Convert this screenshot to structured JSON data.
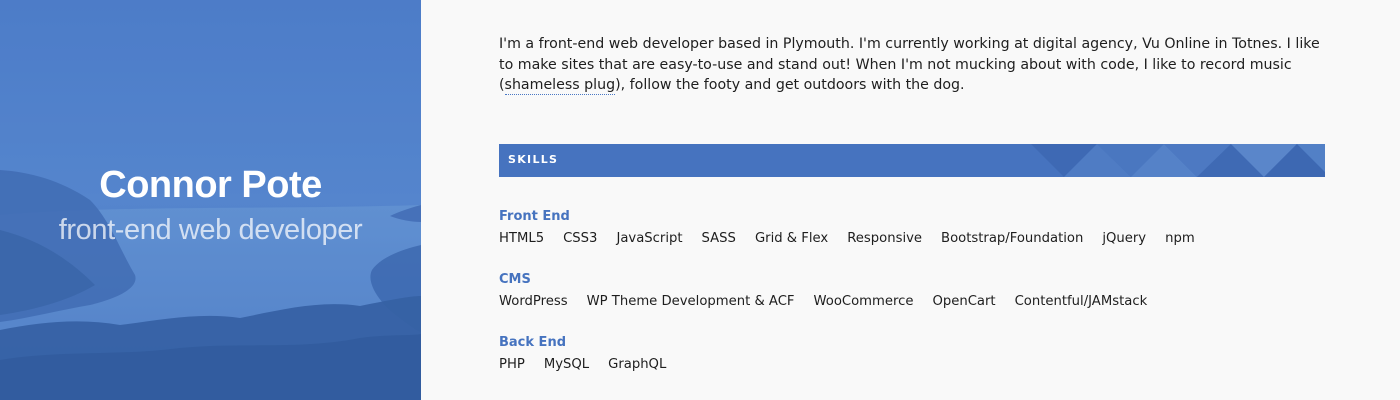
{
  "hero": {
    "name": "Connor Pote",
    "role": "front-end web developer"
  },
  "intro": {
    "text_before_link": "I'm a front-end web developer based in Plymouth. I'm currently working at digital agency, Vu Online in Totnes. I like to make sites that are easy-to-use and stand out! When I'm not mucking about with code, I like to record music (",
    "link_text": "shameless plug",
    "text_after_link": "), follow the footy and get outdoors with the dog."
  },
  "skills": {
    "heading": "SKILLS",
    "groups": [
      {
        "title": "Front End",
        "items": [
          "HTML5",
          "CSS3",
          "JavaScript",
          "SASS",
          "Grid & Flex",
          "Responsive",
          "Bootstrap/Foundation",
          "jQuery",
          "npm"
        ]
      },
      {
        "title": "CMS",
        "items": [
          "WordPress",
          "WP Theme Development & ACF",
          "WooCommerce",
          "OpenCart",
          "Contentful/JAMstack"
        ]
      },
      {
        "title": "Back End",
        "items": [
          "PHP",
          "MySQL",
          "GraphQL"
        ]
      }
    ]
  },
  "colors": {
    "accent": "#4673bf",
    "hero_tint": "#4d7bc6",
    "text": "#1e1e1e",
    "background": "#f9f9f9"
  }
}
